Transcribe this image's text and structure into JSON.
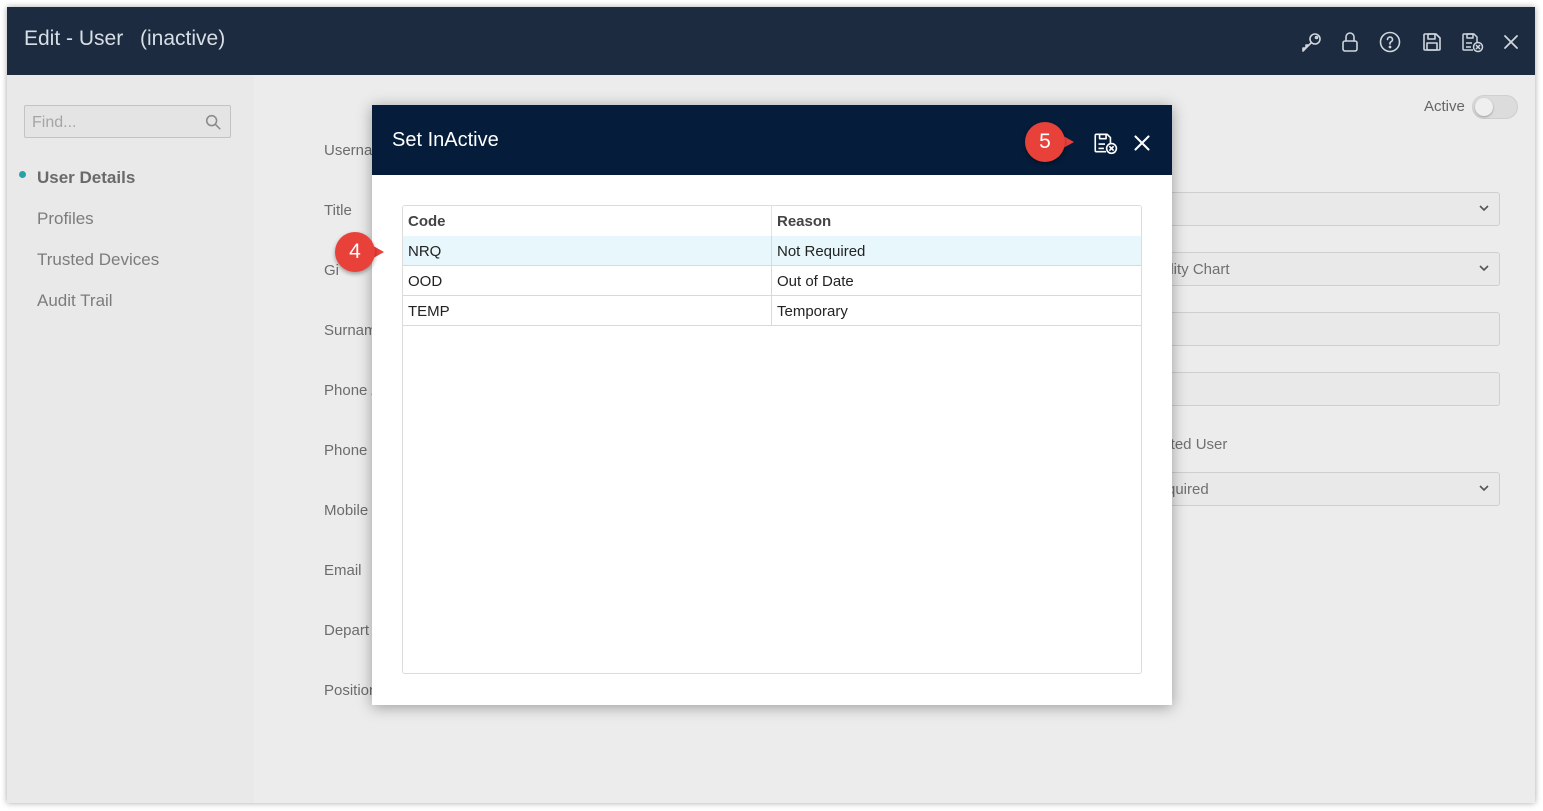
{
  "window": {
    "title": "Edit - User",
    "status": "(inactive)",
    "icons": [
      "key-icon",
      "lock-icon",
      "help-icon",
      "save-icon",
      "save-inactive-icon",
      "close-icon"
    ]
  },
  "sidebar": {
    "search_placeholder": "Find...",
    "items": [
      {
        "label": "User Details",
        "active": true
      },
      {
        "label": "Profiles",
        "active": false
      },
      {
        "label": "Trusted Devices",
        "active": false
      },
      {
        "label": "Audit Trail",
        "active": false
      }
    ]
  },
  "form": {
    "labels": [
      "Userna",
      "Title",
      "Gi",
      "Surnam",
      "Phone /",
      "Phone I",
      "Mobile",
      "Email",
      "Depart",
      "Position"
    ],
    "active_label": "Active",
    "active_on": false,
    "right_fields": [
      "",
      "ility Chart",
      "",
      "",
      "quired"
    ],
    "right_text": "nited User"
  },
  "dialog": {
    "title": "Set InActive",
    "columns": {
      "code": "Code",
      "reason": "Reason"
    },
    "rows": [
      {
        "code": "NRQ",
        "reason": "Not Required",
        "selected": true
      },
      {
        "code": "OOD",
        "reason": "Out of Date",
        "selected": false
      },
      {
        "code": "TEMP",
        "reason": "Temporary",
        "selected": false
      }
    ]
  },
  "callouts": {
    "step4": "4",
    "step5": "5"
  },
  "colors": {
    "titlebar": "#1c2b3f",
    "dialog_header": "#051c3a",
    "accent": "#2aa1a6",
    "callout": "#e8413a",
    "selected_row": "#e7f7fb"
  }
}
